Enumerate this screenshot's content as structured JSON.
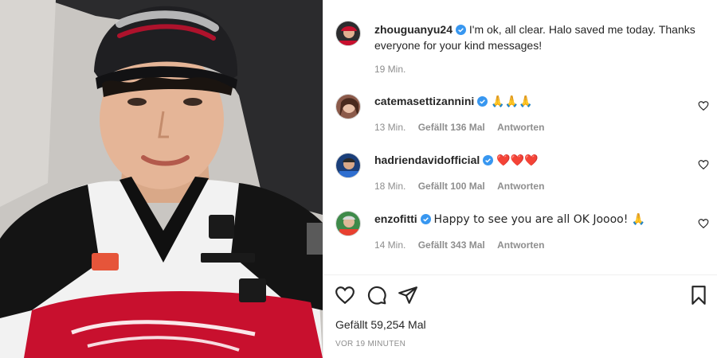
{
  "caption": {
    "username": "zhouguanyu24",
    "text": "I'm ok, all clear. Halo saved me today. Thanks everyone for your kind messages!",
    "time": "19 Min."
  },
  "comments": [
    {
      "username": "catemasettizannini",
      "text": "🙏🙏🙏",
      "time": "13 Min.",
      "likes": "Gefällt 136 Mal",
      "reply": "Antworten"
    },
    {
      "username": "hadriendavidofficial",
      "text": "❤️❤️❤️",
      "time": "18 Min.",
      "likes": "Gefällt 100 Mal",
      "reply": "Antworten"
    },
    {
      "username": "enzofitti",
      "text": "Happy to see you are all OK Joooo! 🙏",
      "time": "14 Min.",
      "likes": "Gefällt 343 Mal",
      "reply": "Antworten"
    }
  ],
  "post": {
    "likes": "Gefällt 59,254 Mal",
    "date": "VOR 19 MINUTEN"
  },
  "colors": {
    "verified": "#3897f0",
    "text": "#262626",
    "muted": "#8e8e8e",
    "jersey_red": "#c8102e"
  },
  "icons": [
    "verified-badge-icon",
    "heart-icon",
    "comment-icon",
    "share-icon",
    "bookmark-icon"
  ]
}
